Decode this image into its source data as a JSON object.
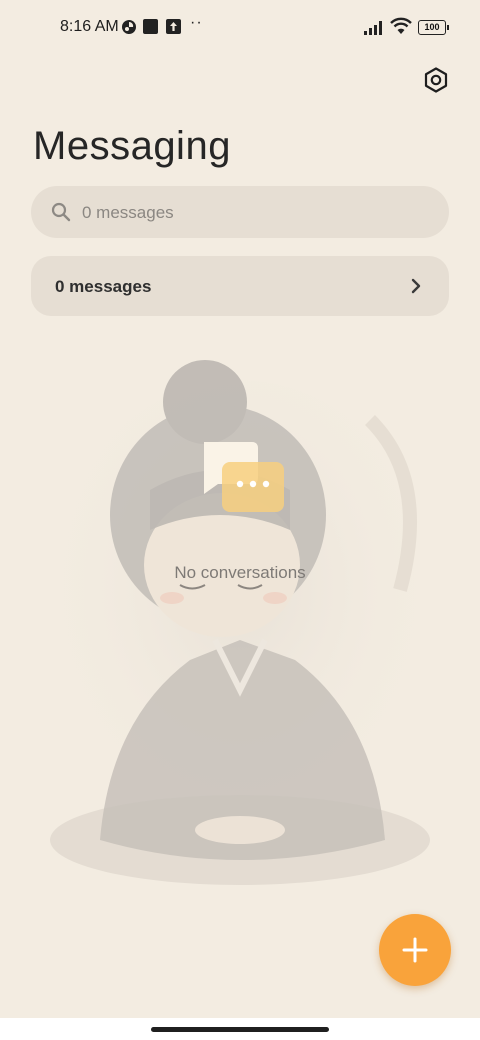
{
  "status_bar": {
    "time": "8:16 AM",
    "battery": "100",
    "icons": [
      "compass-icon",
      "square-icon",
      "upload-icon",
      "more-dots-icon",
      "signal-icon",
      "wifi-icon",
      "battery-icon"
    ]
  },
  "header": {
    "title": "Messaging",
    "settings_icon": "settings-hexagon-icon"
  },
  "search": {
    "placeholder": "0 messages",
    "icon": "search-icon"
  },
  "messages_row": {
    "label": "0 messages",
    "icon": "chevron-right-icon"
  },
  "empty_state": {
    "text": "No conversations",
    "icon": "chat-bubbles-icon"
  },
  "fab": {
    "icon": "plus-icon",
    "color": "#f9a33b"
  },
  "colors": {
    "background": "#f3ece1",
    "card": "#e6ded3",
    "accent": "#f9a33b"
  }
}
